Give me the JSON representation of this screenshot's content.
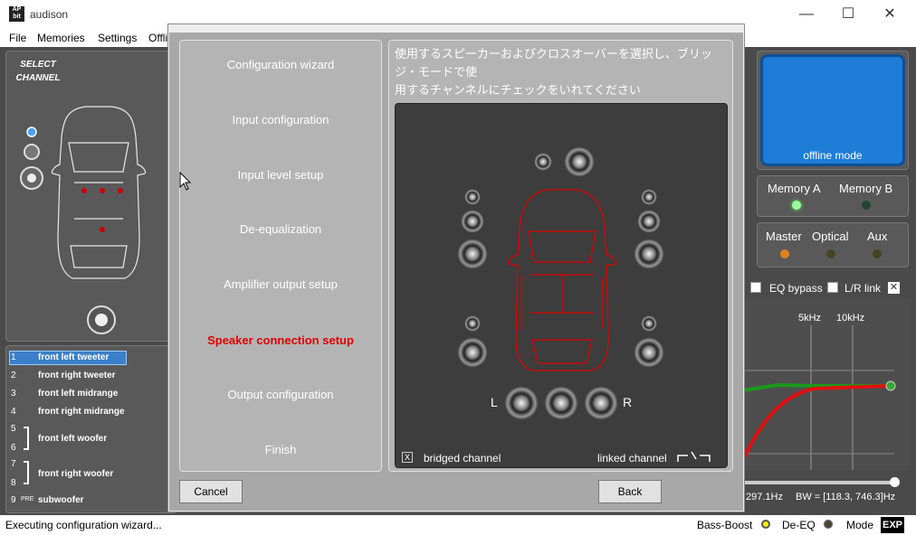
{
  "window": {
    "app_logo": "AP bit",
    "title": "audison",
    "minimize": "—",
    "maximize": "☐",
    "close": "✕"
  },
  "menu": [
    "File",
    "Memories",
    "Settings",
    "Offli"
  ],
  "left": {
    "select_channel": "SELECT CHANNEL",
    "channels": [
      {
        "num": "1",
        "name": "front left tweeter",
        "selected": true
      },
      {
        "num": "2",
        "name": "front right tweeter"
      },
      {
        "num": "3",
        "name": "front left midrange"
      },
      {
        "num": "4",
        "name": "front right midrange"
      },
      {
        "num": "5",
        "name": ""
      },
      {
        "num": "6",
        "name": "front left woofer"
      },
      {
        "num": "7",
        "name": ""
      },
      {
        "num": "8",
        "name": "front right woofer"
      },
      {
        "num": "9",
        "pre": "PRE",
        "name": "subwoofer"
      }
    ]
  },
  "right": {
    "offline": "offline mode",
    "memory_a": "Memory A",
    "memory_b": "Memory B",
    "master": "Master",
    "optical": "Optical",
    "aux": "Aux",
    "eq_bypass": "EQ bypass",
    "lr_link": "L/R link",
    "freq_5k": "5kHz",
    "freq_10k": "10kHz",
    "readout_left": "297.1Hz",
    "readout_bw": "BW = [118.3, 746.3]Hz"
  },
  "dialog": {
    "steps": [
      {
        "label": "Configuration wizard",
        "active": false
      },
      {
        "label": "Input configuration",
        "active": false
      },
      {
        "label": "Input level setup",
        "active": false
      },
      {
        "label": "De-equalization",
        "active": false
      },
      {
        "label": "Amplifier output setup",
        "active": false
      },
      {
        "label": "Speaker connection setup",
        "active": true
      },
      {
        "label": "Output configuration",
        "active": false
      },
      {
        "label": "Finish",
        "active": false
      }
    ],
    "instruction_line1": "使用するスピーカーおよびクロスオーバーを選択し、ブリッジ・モードで使",
    "instruction_line2": "用するチャンネルにチェックをいれてください",
    "left_label": "L",
    "right_label": "R",
    "bridged_box": "X",
    "bridged_channel": "bridged channel",
    "linked_channel": "linked channel",
    "cancel": "Cancel",
    "back": "Back"
  },
  "status": {
    "message": "Executing configuration wizard...",
    "bass_boost": "Bass-Boost",
    "de_eq": "De-EQ",
    "mode": "Mode",
    "exp": "EXP"
  },
  "colors": {
    "accent_red": "#e00000",
    "offline_blue": "#1e7dd6",
    "selected_blue": "#3a7fc8"
  }
}
